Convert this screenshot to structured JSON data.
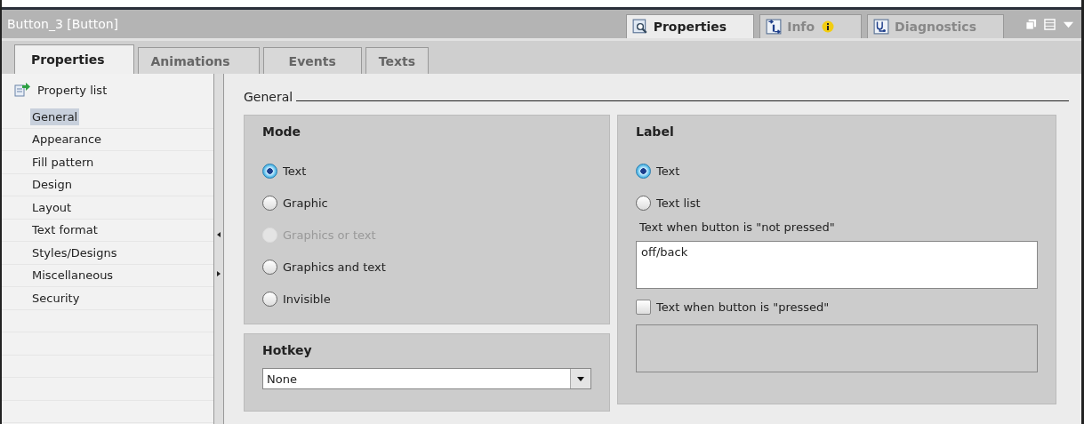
{
  "header": {
    "title": "Button_3 [Button]"
  },
  "view_tabs": [
    {
      "label": "Properties",
      "selected": true,
      "kind": "properties",
      "badge": false
    },
    {
      "label": "Info",
      "selected": false,
      "kind": "info",
      "badge": true
    },
    {
      "label": "Diagnostics",
      "selected": false,
      "kind": "diagnostics",
      "badge": false
    }
  ],
  "tabs": [
    {
      "label": "Properties",
      "selected": true
    },
    {
      "label": "Animations",
      "selected": false
    },
    {
      "label": "Events",
      "selected": false
    },
    {
      "label": "Texts",
      "selected": false
    }
  ],
  "sidebar": {
    "title": "Property list",
    "items": [
      {
        "label": "General",
        "selected": true
      },
      {
        "label": "Appearance",
        "selected": false
      },
      {
        "label": "Fill pattern",
        "selected": false
      },
      {
        "label": "Design",
        "selected": false
      },
      {
        "label": "Layout",
        "selected": false
      },
      {
        "label": "Text format",
        "selected": false
      },
      {
        "label": "Styles/Designs",
        "selected": false
      },
      {
        "label": "Miscellaneous",
        "selected": false
      },
      {
        "label": "Security",
        "selected": false
      }
    ]
  },
  "section": {
    "title": "General"
  },
  "mode": {
    "title": "Mode",
    "options": [
      {
        "label": "Text",
        "selected": true,
        "disabled": false
      },
      {
        "label": "Graphic",
        "selected": false,
        "disabled": false
      },
      {
        "label": "Graphics or text",
        "selected": false,
        "disabled": true
      },
      {
        "label": "Graphics and text",
        "selected": false,
        "disabled": false
      },
      {
        "label": "Invisible",
        "selected": false,
        "disabled": false
      }
    ]
  },
  "hotkey": {
    "title": "Hotkey",
    "value": "None"
  },
  "label": {
    "title": "Label",
    "options": [
      {
        "label": "Text",
        "selected": true
      },
      {
        "label": "Text list",
        "selected": false
      }
    ],
    "not_pressed_label": "Text when button is \"not pressed\"",
    "not_pressed_value": "off/back",
    "pressed_checkbox": {
      "label": "Text when button is \"pressed\"",
      "checked": false
    }
  }
}
